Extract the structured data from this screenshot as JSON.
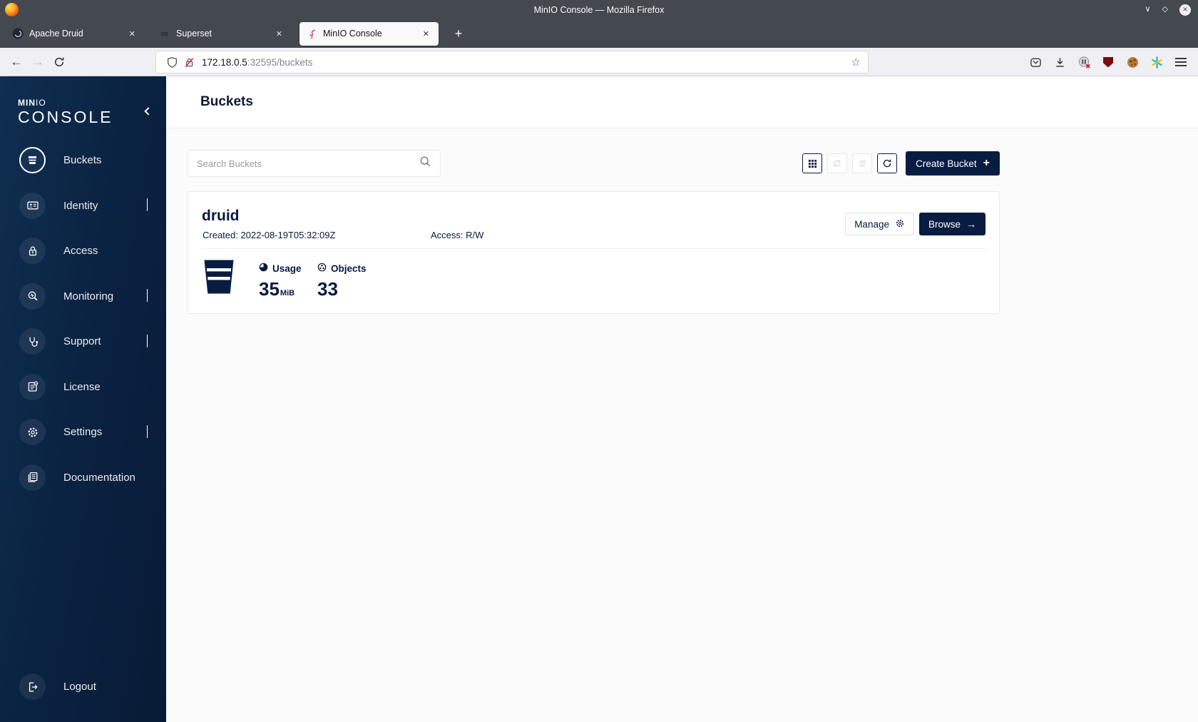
{
  "window": {
    "title": "MinIO Console — Mozilla Firefox"
  },
  "icons": {
    "window_minimize": "∨",
    "window_maximize": "◇",
    "window_close": "✕",
    "tab_close": "✕",
    "new_tab": "+",
    "back": "←",
    "forward": "→",
    "bookmark_star": "☆",
    "superset_logo": "∞",
    "browse_arrow": "→",
    "create_plus": "+"
  },
  "tabs": [
    {
      "label": "Apache Druid"
    },
    {
      "label": "Superset"
    },
    {
      "label": "MinIO Console"
    }
  ],
  "urlbar": {
    "host": "172.18.0.5",
    "path": ":32595/buckets"
  },
  "sidebar": {
    "logo": {
      "brand_bold": "MIN",
      "brand_light": "IO",
      "product": "CONSOLE"
    },
    "items": [
      {
        "label": "Buckets"
      },
      {
        "label": "Identity"
      },
      {
        "label": "Access"
      },
      {
        "label": "Monitoring"
      },
      {
        "label": "Support"
      },
      {
        "label": "License"
      },
      {
        "label": "Settings"
      },
      {
        "label": "Documentation"
      }
    ],
    "logout_label": "Logout"
  },
  "main": {
    "page_title": "Buckets",
    "search_placeholder": "Search Buckets",
    "create_button_label": "Create Bucket",
    "bucket_card": {
      "name": "druid",
      "created": "Created: 2022-08-19T05:32:09Z",
      "access": "Access: R/W",
      "manage_label": "Manage",
      "browse_label": "Browse",
      "usage_label": "Usage",
      "usage_value": "35",
      "usage_unit": "MiB",
      "objects_label": "Objects",
      "objects_value": "33"
    }
  },
  "colors": {
    "brand_navy": "#081c42",
    "sidebar_gradient_start": "#0f2e50",
    "sidebar_gradient_end": "#081b36",
    "titlebar_gray": "#43494f",
    "flamingo_red": "#d13a52"
  }
}
